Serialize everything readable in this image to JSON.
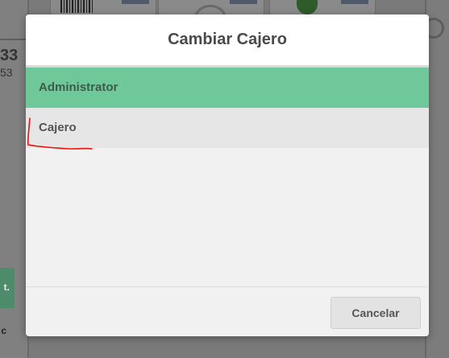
{
  "background": {
    "number_large": "33",
    "number_small": "53",
    "green_tab_text": "t.",
    "small_text": "c"
  },
  "modal": {
    "title": "Cambiar Cajero",
    "items": [
      {
        "label": "Administrator",
        "selected": true
      },
      {
        "label": "Cajero",
        "selected": false
      }
    ],
    "cancel_label": "Cancelar"
  },
  "colors": {
    "selected_item": "#6fc89a",
    "annotation_stroke": "#e8120c"
  }
}
